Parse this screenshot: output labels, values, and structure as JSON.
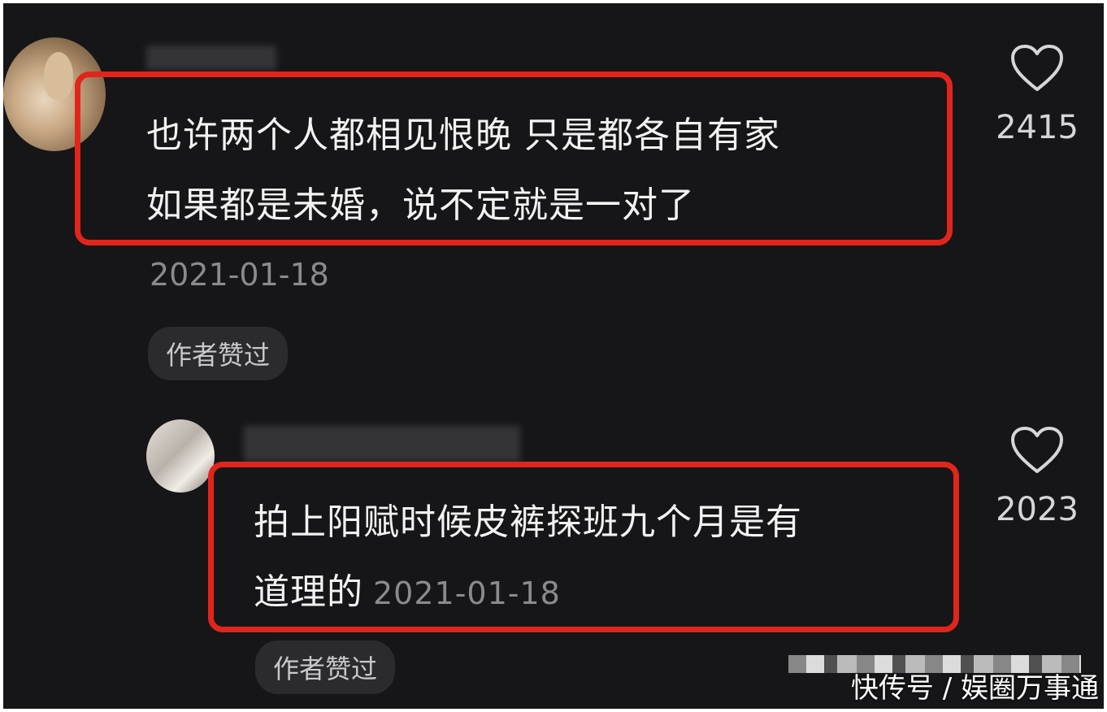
{
  "comments": [
    {
      "text_line1": "也许两个人都相见恨晚 只是都各自有家",
      "text_line2": "如果都是未婚，说不定就是一对了",
      "date": "2021-01-18",
      "badge": "作者赞过",
      "likes": "2415"
    },
    {
      "text_line1": "拍上阳赋时候皮裤探班九个月是有",
      "text_line2": "道理的",
      "date": "2021-01-18",
      "badge": "作者赞过",
      "likes": "2023"
    }
  ],
  "watermark": "快传号 / 娱圈万事通",
  "colors": {
    "background": "#161618",
    "highlight_border": "#e1251b",
    "text": "#f2f2f2",
    "muted": "#8a8a8f"
  },
  "icons": {
    "like": "heart-outline-icon"
  }
}
